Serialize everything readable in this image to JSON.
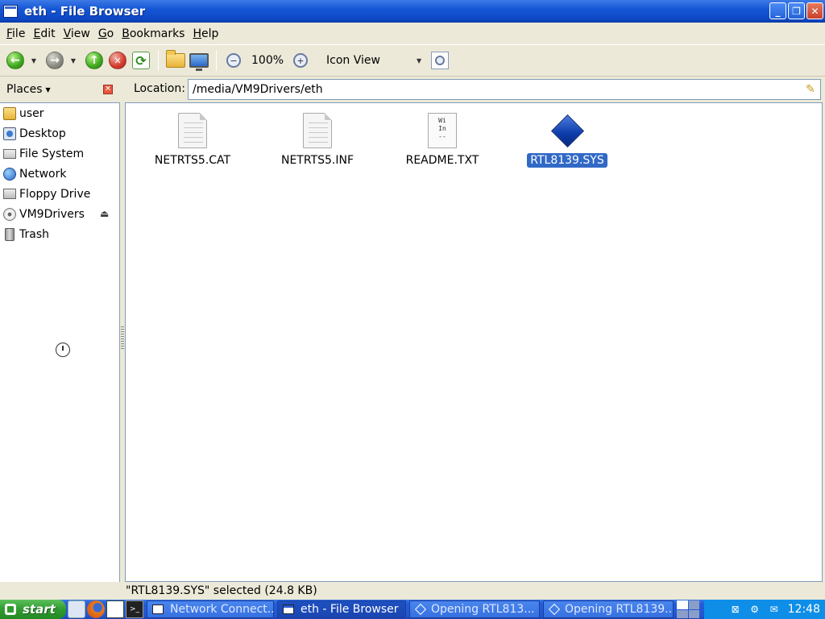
{
  "window": {
    "title": "eth - File Browser",
    "controls": {
      "minimize": "_",
      "maximize": "❐",
      "close": "✕"
    }
  },
  "menubar": {
    "items": [
      {
        "label_first": "F",
        "label_rest": "ile"
      },
      {
        "label_first": "E",
        "label_rest": "dit"
      },
      {
        "label_first": "V",
        "label_rest": "iew"
      },
      {
        "label_first": "G",
        "label_rest": "o"
      },
      {
        "label_first": "B",
        "label_rest": "ookmarks"
      },
      {
        "label_first": "H",
        "label_rest": "elp"
      }
    ]
  },
  "toolbar": {
    "zoom": "100%",
    "view_mode": "Icon View",
    "icons": [
      "back-icon",
      "forward-icon",
      "up-icon",
      "stop-icon",
      "reload-icon",
      "home-folder-icon",
      "computer-icon",
      "zoom-out-icon",
      "zoom-in-icon",
      "find-icon"
    ]
  },
  "places": {
    "header": "Places",
    "items": [
      {
        "label": "user",
        "icon": "home-icon"
      },
      {
        "label": "Desktop",
        "icon": "desktop-icon"
      },
      {
        "label": "File System",
        "icon": "filesystem-icon"
      },
      {
        "label": "Network",
        "icon": "network-icon"
      },
      {
        "label": "Floppy Drive",
        "icon": "floppy-icon"
      },
      {
        "label": "VM9Drivers",
        "icon": "cdrom-icon"
      },
      {
        "label": "Trash",
        "icon": "trash-icon"
      }
    ]
  },
  "location": {
    "label": "Location:",
    "value": "/media/VM9Drivers/eth"
  },
  "files": [
    {
      "name": "NETRTS5.CAT",
      "icon": "document-icon",
      "selected": false
    },
    {
      "name": "NETRTS5.INF",
      "icon": "document-icon",
      "selected": false
    },
    {
      "name": "README.TXT",
      "icon": "text-file-icon",
      "preview": [
        "Wi",
        "In",
        "--"
      ],
      "selected": false
    },
    {
      "name": "RTL8139.SYS",
      "icon": "system-file-icon",
      "selected": true
    }
  ],
  "status": {
    "text": "\"RTL8139.SYS\" selected (24.8 KB)"
  },
  "taskbar": {
    "start_label": "start",
    "tasks": [
      {
        "label": "Network Connect...",
        "active": false
      },
      {
        "label": "eth - File Browser",
        "active": true
      },
      {
        "label": "Opening RTL813...",
        "active": false
      },
      {
        "label": "Opening RTL8139...",
        "active": false
      }
    ],
    "clock": "12:48"
  },
  "colors": {
    "selection": "#3169c6",
    "titlebar": "#1457d6",
    "taskbar": "#245ed8"
  }
}
